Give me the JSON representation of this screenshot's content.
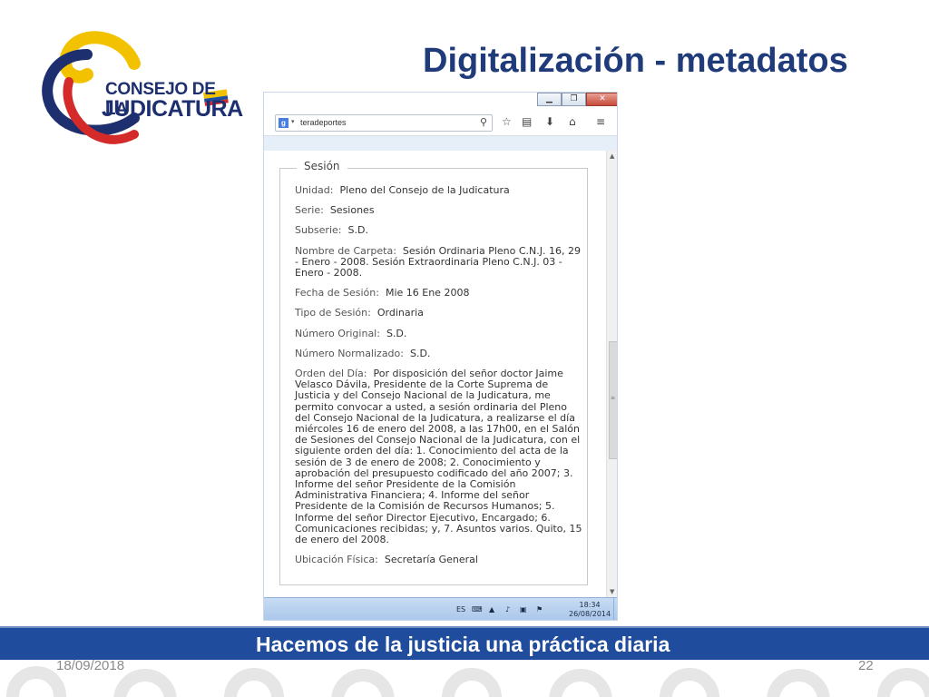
{
  "slide": {
    "title": "Digitalización - metadatos",
    "logo": {
      "line1": "CONSEJO DE LA",
      "line2": "JUDICATURA"
    },
    "banner": "Hacemos de la justicia una práctica diaria",
    "date": "18/09/2018",
    "page_number": "22"
  },
  "browser": {
    "window_buttons": [
      "▁",
      "❐",
      "✕"
    ],
    "search": {
      "engine": "g",
      "value": "teradeportes"
    },
    "fieldset_legend": "Sesión",
    "fields": [
      {
        "label": "Unidad:",
        "value": "Pleno del Consejo de la Judicatura"
      },
      {
        "label": "Serie:",
        "value": "Sesiones"
      },
      {
        "label": "Subserie:",
        "value": "S.D."
      },
      {
        "label": "Nombre de Carpeta:",
        "value": "Sesión Ordinaria Pleno C.N.J. 16, 29 - Enero - 2008. Sesión Extraordinaria Pleno C.N.J. 03 - Enero - 2008."
      },
      {
        "label": "Fecha de Sesión:",
        "value": "Mie 16 Ene 2008"
      },
      {
        "label": "Tipo de Sesión:",
        "value": "Ordinaria"
      },
      {
        "label": "Número Original:",
        "value": "S.D."
      },
      {
        "label": "Número Normalizado:",
        "value": "S.D."
      },
      {
        "label": "Orden del Día:",
        "value": "Por disposición del señor doctor Jaime Velasco Dávila, Presidente de la Corte Suprema de Justicia y del Consejo Nacional de la Judicatura, me permito convocar a usted, a sesión ordinaria del Pleno del Consejo Nacional de la Judicatura, a realizarse el día miércoles 16 de enero del 2008, a las 17h00, en el Salón de Sesiones del Consejo Nacional de la Judicatura, con el siguiente orden del día: 1. Conocimiento del acta de la sesión de 3 de enero de 2008; 2. Conocimiento y aprobación del presupuesto codificado del año 2007; 3. Informe del señor Presidente de la Comisión Administrativa Financiera; 4. Informe del señor Presidente de la Comisión de Recursos Humanos; 5. Informe del señor Director Ejecutivo, Encargado; 6. Comunicaciones recibidas; y, 7. Asuntos varios. Quito, 15 de enero del 2008."
      },
      {
        "label": "Ubicación Física:",
        "value": "Secretaría General"
      }
    ],
    "taskbar": {
      "language": "ES",
      "time": "18:34",
      "date": "26/08/2014"
    }
  },
  "colors": {
    "title": "#1f3b7a",
    "banner": "#1f4c9c",
    "logo_blue": "#1d2f6f",
    "logo_yellow": "#f2c200",
    "logo_red": "#d42a2a"
  }
}
